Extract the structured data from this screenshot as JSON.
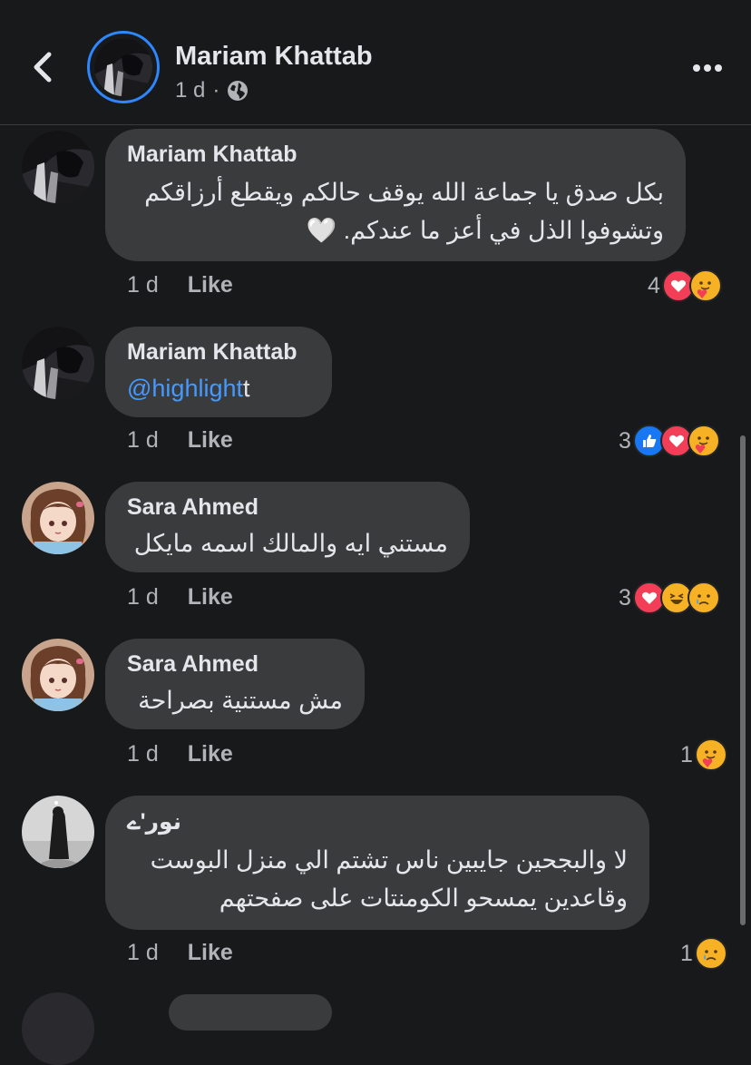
{
  "header": {
    "name": "Mariam Khattab",
    "time": "1 d",
    "dot": "·",
    "audience_icon": "globe-icon"
  },
  "comments": [
    {
      "author": "Mariam Khattab",
      "lines": [
        "بكل صدق يا جماعة الله يوقف حالكم ويقطع أرزاقكم",
        "وتشوفوا الذل في أعز ما عندكم. 🤍"
      ],
      "time": "1 d",
      "like_label": "Like",
      "reaction_count": "4",
      "reactions": [
        "love",
        "care"
      ]
    },
    {
      "author": "Mariam Khattab",
      "mention": "@highlight",
      "mention_tail": "t",
      "time": "1 d",
      "like_label": "Like",
      "reaction_count": "3",
      "reactions": [
        "like",
        "love",
        "care"
      ]
    },
    {
      "author": "Sara Ahmed",
      "lines": [
        "مستني ايه والمالك اسمه مايكل"
      ],
      "time": "1 d",
      "like_label": "Like",
      "reaction_count": "3",
      "reactions": [
        "love",
        "haha",
        "sad"
      ]
    },
    {
      "author": "Sara Ahmed",
      "lines": [
        "مش مستنية بصراحة"
      ],
      "time": "1 d",
      "like_label": "Like",
      "reaction_count": "1",
      "reactions": [
        "care"
      ]
    },
    {
      "author": "نور'ے",
      "lines": [
        "لا والبجحين جايبين ناس تشتم الي منزل البوست",
        "وقاعدين يمسحو الكومنتات على صفحتهم"
      ],
      "time": "1 d",
      "like_label": "Like",
      "reaction_count": "1",
      "reactions": [
        "sad"
      ]
    }
  ],
  "colors": {
    "background": "#18191a",
    "bubble": "#3a3b3c",
    "mention": "#4599ff",
    "avatar_ring": "#2d88ff",
    "secondary_text": "#b0b3b8"
  }
}
